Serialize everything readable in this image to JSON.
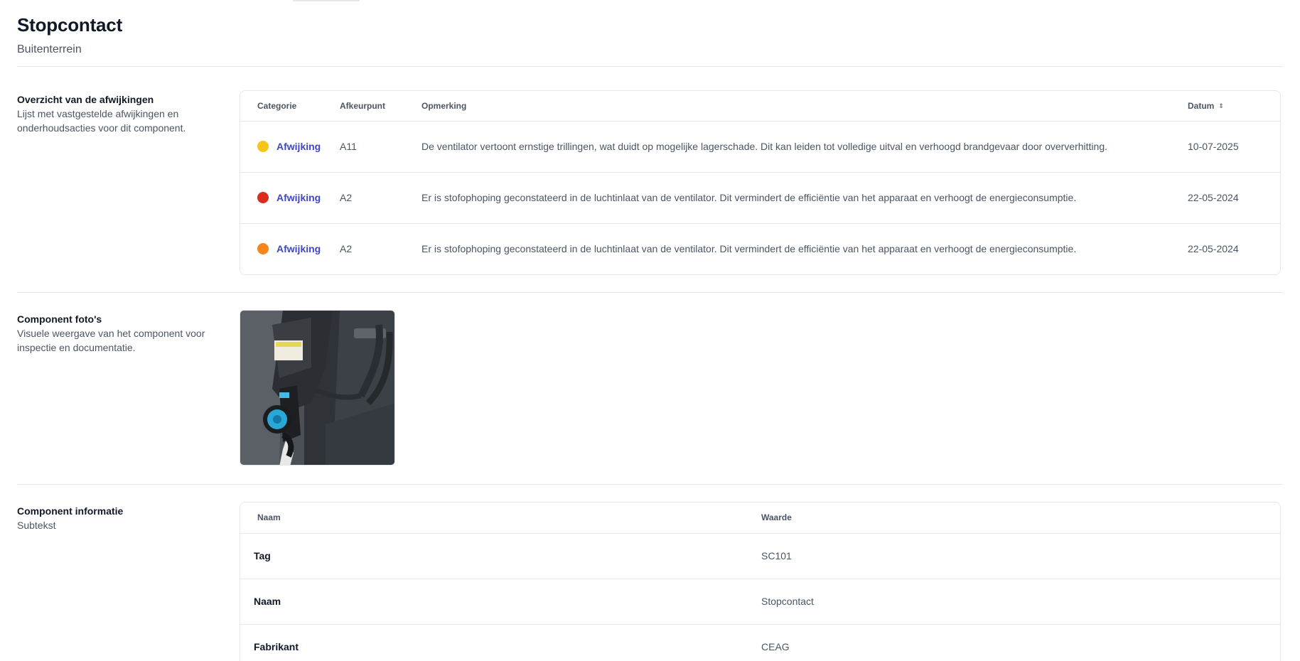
{
  "header": {
    "title": "Stopcontact",
    "subtitle": "Buitenterrein"
  },
  "deviations": {
    "title": "Overzicht van de afwijkingen",
    "description": "Lijst met vastgestelde afwijkingen en onderhoudsacties voor dit component.",
    "columns": {
      "category": "Categorie",
      "point": "Afkeurpunt",
      "remark": "Opmerking",
      "date": "Datum"
    },
    "rows": [
      {
        "category": "Afwijking",
        "color": "#f5c518",
        "point": "A11",
        "remark": "De ventilator vertoont ernstige trillingen, wat duidt op mogelijke lagerschade. Dit kan leiden tot volledige uitval en verhoogd brandgevaar door oververhitting.",
        "date": "10-07-2025"
      },
      {
        "category": "Afwijking",
        "color": "#d92d20",
        "point": "A2",
        "remark": "Er is stofophoping geconstateerd in de luchtinlaat van de ventilator. Dit vermindert de efficiëntie van het apparaat en verhoogt de energieconsumptie.",
        "date": "22-05-2024"
      },
      {
        "category": "Afwijking",
        "color": "#f7851e",
        "point": "A2",
        "remark": "Er is stofophoping geconstateerd in de luchtinlaat van de ventilator. Dit vermindert de efficiëntie van het apparaat en verhoogt de energieconsumptie.",
        "date": "22-05-2024"
      }
    ]
  },
  "photos": {
    "title": "Component foto's",
    "description": "Visuele weergave van het component voor inspectie en documentatie."
  },
  "info": {
    "title": "Component informatie",
    "description": "Subtekst",
    "columns": {
      "name": "Naam",
      "value": "Waarde"
    },
    "rows": [
      {
        "name": "Tag",
        "value": "SC101"
      },
      {
        "name": "Naam",
        "value": "Stopcontact"
      },
      {
        "name": "Fabrikant",
        "value": "CEAG"
      }
    ]
  },
  "icons": {
    "sort": "sort-updown-icon"
  },
  "colors": {
    "link": "#4047c4",
    "border": "#e5e7eb"
  }
}
